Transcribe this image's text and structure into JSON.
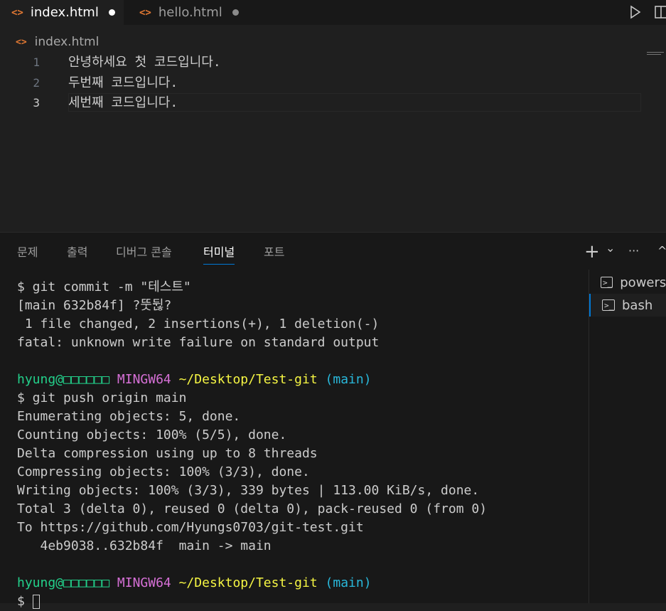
{
  "tabs": [
    {
      "icon": "<>",
      "label": "index.html",
      "modified": true
    },
    {
      "icon": "<>",
      "label": "hello.html",
      "modified": true
    }
  ],
  "breadcrumb": {
    "icon": "<>",
    "label": "index.html"
  },
  "editor": {
    "current_line": 3,
    "lines": [
      {
        "num": "1",
        "text": "안녕하세요 첫 코드입니다."
      },
      {
        "num": "2",
        "text": "두번째 코드입니다."
      },
      {
        "num": "3",
        "text": "세번째 코드입니다."
      }
    ]
  },
  "panel": {
    "tabs": [
      "문제",
      "출력",
      "디버그 콘솔",
      "터미널",
      "포트"
    ],
    "active_tab": "터미널",
    "actions": {
      "add": "+",
      "dropdown": "⌄",
      "more": "···",
      "collapse": "^"
    }
  },
  "terminal": {
    "lines": [
      "$ git commit -m \"테스트\"",
      "[main 632b84f] ?뚯뒪?",
      " 1 file changed, 2 insertions(+), 1 deletion(-)",
      "fatal: unknown write failure on standard output",
      "",
      "PROMPT",
      "$ git push origin main",
      "Enumerating objects: 5, done.",
      "Counting objects: 100% (5/5), done.",
      "Delta compression using up to 8 threads",
      "Compressing objects: 100% (3/3), done.",
      "Writing objects: 100% (3/3), 339 bytes | 113.00 KiB/s, done.",
      "Total 3 (delta 0), reused 0 (delta 0), pack-reused 0 (from 0)",
      "To https://github.com/Hyungs0703/git-test.git",
      "   4eb9038..632b84f  main -> main",
      "",
      "PROMPT"
    ],
    "prompt": {
      "user": "hyung@□□□□□□",
      "system": "MINGW64",
      "path": "~/Desktop/Test-git",
      "branch": "(main)"
    },
    "input_prefix": "$ "
  },
  "terminal_list": [
    {
      "label": "powershell",
      "selected": false
    },
    {
      "label": "bash",
      "selected": true
    }
  ]
}
